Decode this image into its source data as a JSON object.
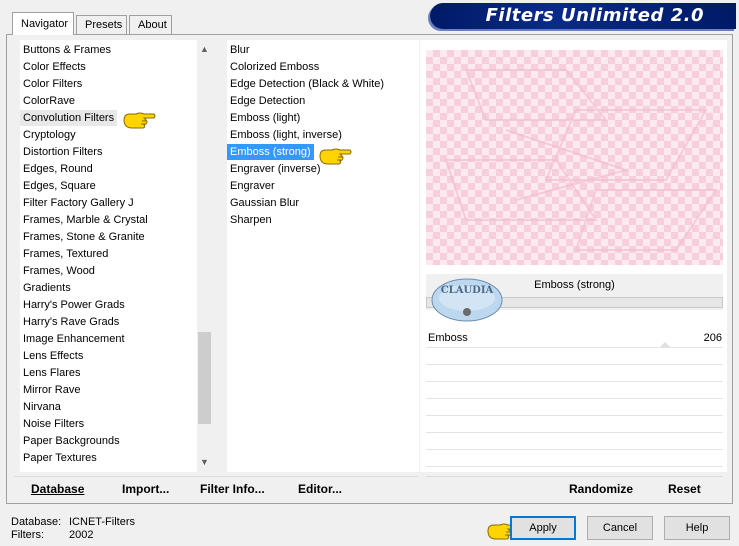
{
  "banner": {
    "title": "Filters Unlimited 2.0"
  },
  "tabs": [
    {
      "label": "Navigator",
      "active": true
    },
    {
      "label": "Presets",
      "active": false
    },
    {
      "label": "About",
      "active": false
    }
  ],
  "categories": [
    "Buttons & Frames",
    "Color Effects",
    "Color Filters",
    "ColorRave",
    "Convolution Filters",
    "Cryptology",
    "Distortion Filters",
    "Edges, Round",
    "Edges, Square",
    "Filter Factory Gallery J",
    "Frames, Marble & Crystal",
    "Frames, Stone & Granite",
    "Frames, Textured",
    "Frames, Wood",
    "Gradients",
    "Harry's Power Grads",
    "Harry's Rave Grads",
    "Image Enhancement",
    "Lens Effects",
    "Lens Flares",
    "Mirror Rave",
    "Nirvana",
    "Noise Filters",
    "Paper Backgrounds",
    "Paper Textures"
  ],
  "selected_category": "Convolution Filters",
  "filters": [
    "Blur",
    "Colorized Emboss",
    "Edge Detection (Black & White)",
    "Edge Detection",
    "Emboss (light)",
    "Emboss (light, inverse)",
    "Emboss (strong)",
    "Engraver (inverse)",
    "Engraver",
    "Gaussian Blur",
    "Sharpen"
  ],
  "selected_filter": "Emboss (strong)",
  "filter_panel": {
    "name": "Emboss (strong)",
    "param_label": "Emboss",
    "param_value": "206"
  },
  "bottom_bar": {
    "database": "Database",
    "import": "Import...",
    "filter_info": "Filter Info...",
    "editor": "Editor...",
    "randomize": "Randomize",
    "reset": "Reset"
  },
  "status": {
    "database_label": "Database:",
    "database_value": "ICNET-Filters",
    "filters_label": "Filters:",
    "filters_value": "2002"
  },
  "buttons": {
    "apply": "Apply",
    "cancel": "Cancel",
    "help": "Help"
  },
  "watermark": {
    "text": "CLAUDIA"
  },
  "colors": {
    "banner": "#0a2a8a",
    "selection": "#3399ff",
    "preview_pink": "#f7cfdc"
  }
}
